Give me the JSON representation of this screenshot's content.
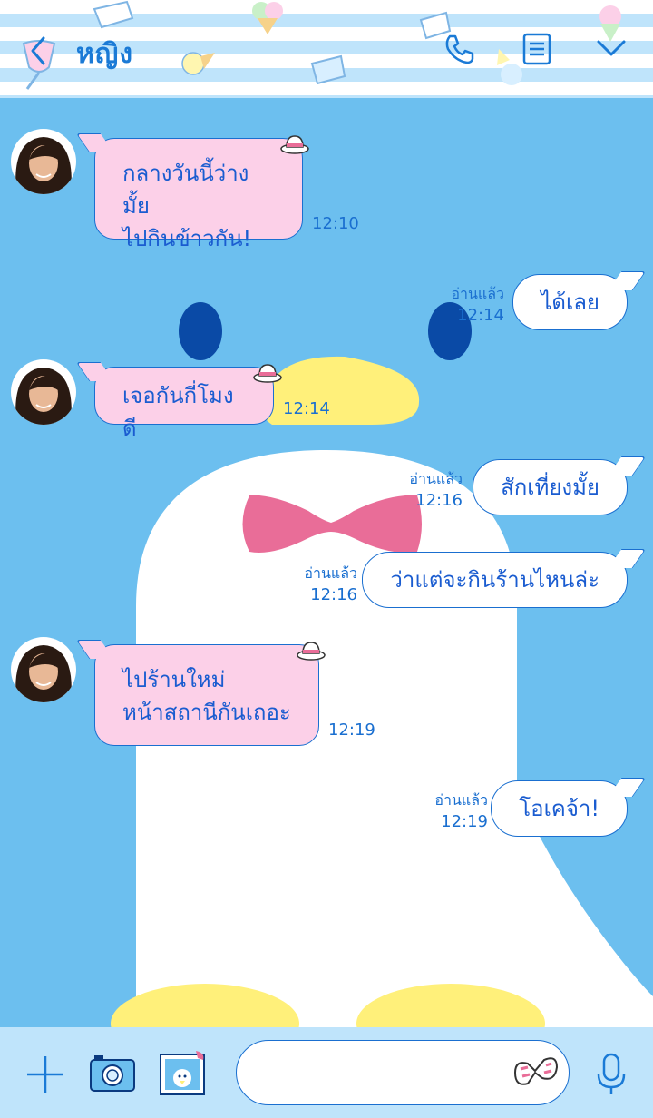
{
  "header": {
    "title": "หญิง",
    "icons": [
      "back-icon",
      "phone-icon",
      "notes-icon",
      "chevron-down-icon"
    ]
  },
  "messages": [
    {
      "side": "in",
      "text_lines": [
        "กลางวันนี้ว่างมั้ย",
        "ไปกินข้าวกัน!"
      ],
      "time": "12:10"
    },
    {
      "side": "out",
      "text": "ได้เลย",
      "read": "อ่านแล้ว",
      "time": "12:14"
    },
    {
      "side": "in",
      "text_lines": [
        "เจอกันกี่โมงดี"
      ],
      "time": "12:14"
    },
    {
      "side": "out",
      "text": "สักเที่ยงมั้ย",
      "read": "อ่านแล้ว",
      "time": "12:16"
    },
    {
      "side": "out",
      "text": "ว่าแต่จะกินร้านไหนล่ะ",
      "read": "อ่านแล้ว",
      "time": "12:16"
    },
    {
      "side": "in",
      "text_lines": [
        "ไปร้านใหม่",
        "หน้าสถานีกันเถอะ"
      ],
      "time": "12:19"
    },
    {
      "side": "out",
      "text": "โอเคจ้า!",
      "read": "อ่านแล้ว",
      "time": "12:19"
    }
  ],
  "footer": {
    "icons": [
      "plus-icon",
      "camera-icon",
      "photo-icon",
      "sticker-icon",
      "mic-icon"
    ],
    "input_placeholder": ""
  },
  "colors": {
    "background": "#6cbfef",
    "accent": "#1a6fd0",
    "incoming_bubble": "#fcd0e8",
    "outgoing_bubble": "#ffffff"
  }
}
